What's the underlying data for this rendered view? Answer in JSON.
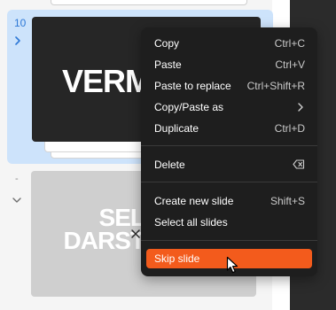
{
  "slides": [
    {
      "number": "10",
      "title_text": "VERM"
    },
    {
      "number": "-",
      "title_line1": "SEL",
      "title_line2": "DARST"
    }
  ],
  "context_menu": {
    "items": [
      {
        "label": "Copy",
        "shortcut": "Ctrl+C"
      },
      {
        "label": "Paste",
        "shortcut": "Ctrl+V"
      },
      {
        "label": "Paste to replace",
        "shortcut": "Ctrl+Shift+R"
      },
      {
        "label": "Copy/Paste as",
        "submenu_icon": "chevron-right-icon"
      },
      {
        "label": "Duplicate",
        "shortcut": "Ctrl+D"
      },
      {
        "label": "Delete",
        "icon": "backspace-icon"
      },
      {
        "label": "Create new slide",
        "shortcut": "Shift+S"
      },
      {
        "label": "Select all slides"
      },
      {
        "label": "Skip slide",
        "highlighted": true
      }
    ]
  },
  "colors": {
    "selection_bg": "#cde3fb",
    "accent_blue": "#2e78d6",
    "menu_bg": "#1e1e1e",
    "highlight": "#f35b1c"
  }
}
